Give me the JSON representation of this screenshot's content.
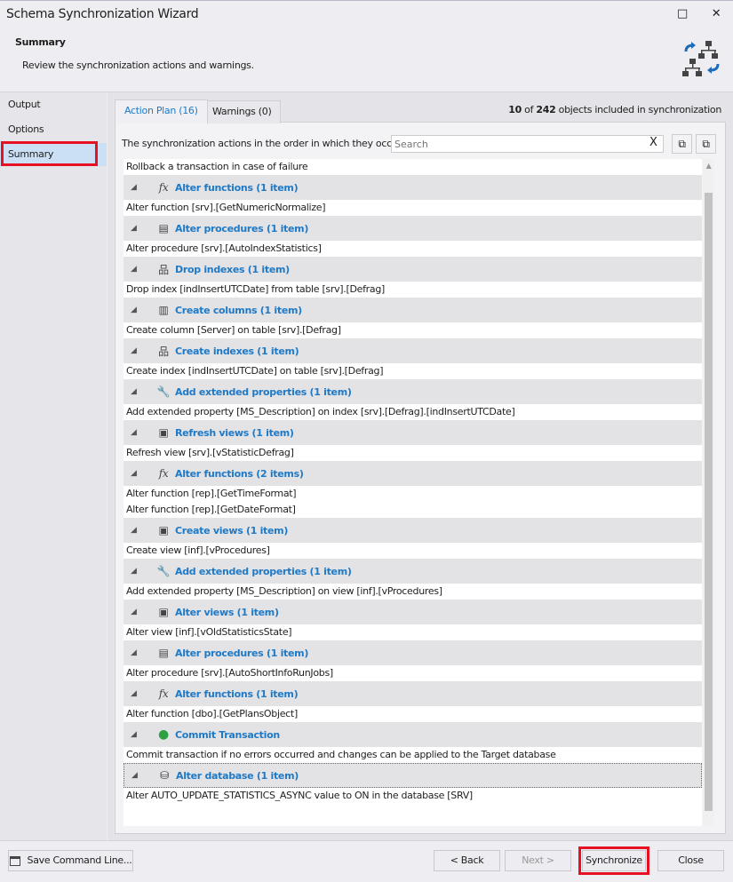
{
  "window": {
    "title": "Schema Synchronization Wizard",
    "maximize_icon": "□",
    "close_icon": "✕"
  },
  "header": {
    "title": "Summary",
    "subtitle": "Review the synchronization actions and warnings."
  },
  "sidebar": {
    "items": [
      {
        "label": "Output"
      },
      {
        "label": "Options"
      },
      {
        "label": "Summary"
      }
    ]
  },
  "tabs": [
    {
      "label": "Action Plan (16)"
    },
    {
      "label": "Warnings (0)"
    }
  ],
  "count": {
    "included": "10",
    "of": " of ",
    "total": "242",
    "suffix": " objects included in synchronization"
  },
  "description": "The synchronization actions in the order in which they occur.",
  "search": {
    "placeholder": "Search",
    "value": "",
    "clear": "X"
  },
  "list": {
    "first": "Rollback a transaction in case of failure",
    "groups": [
      {
        "label": "Alter functions (1 item)",
        "icon": "fx",
        "items": [
          "Alter function [srv].[GetNumericNormalize]"
        ]
      },
      {
        "label": "Alter procedures (1 item)",
        "icon": "procedure",
        "items": [
          "Alter procedure [srv].[AutoIndexStatistics]"
        ]
      },
      {
        "label": "Drop indexes (1 item)",
        "icon": "index",
        "items": [
          "Drop index [indInsertUTCDate] from table [srv].[Defrag]"
        ]
      },
      {
        "label": "Create columns (1 item)",
        "icon": "column",
        "items": [
          "Create column [Server] on table [srv].[Defrag]"
        ]
      },
      {
        "label": "Create indexes (1 item)",
        "icon": "index",
        "items": [
          "Create index [indInsertUTCDate] on table [srv].[Defrag]"
        ]
      },
      {
        "label": "Add extended properties (1 item)",
        "icon": "wrench",
        "items": [
          "Add extended property [MS_Description] on index [srv].[Defrag].[indInsertUTCDate]"
        ]
      },
      {
        "label": "Refresh views (1 item)",
        "icon": "view",
        "items": [
          "Refresh view [srv].[vStatisticDefrag]"
        ]
      },
      {
        "label": "Alter functions (2 items)",
        "icon": "fx",
        "items": [
          "Alter function [rep].[GetTimeFormat]",
          "Alter function [rep].[GetDateFormat]"
        ]
      },
      {
        "label": "Create views (1 item)",
        "icon": "view",
        "items": [
          "Create view [inf].[vProcedures]"
        ]
      },
      {
        "label": "Add extended properties (1 item)",
        "icon": "wrench",
        "items": [
          "Add extended property [MS_Description] on view [inf].[vProcedures]"
        ]
      },
      {
        "label": "Alter views (1 item)",
        "icon": "view",
        "items": [
          "Alter view [inf].[vOldStatisticsState]"
        ]
      },
      {
        "label": "Alter procedures (1 item)",
        "icon": "procedure",
        "items": [
          "Alter procedure [srv].[AutoShortInfoRunJobs]"
        ]
      },
      {
        "label": "Alter functions (1 item)",
        "icon": "fx",
        "items": [
          "Alter function [dbo].[GetPlansObject]"
        ]
      },
      {
        "label": "Commit Transaction",
        "icon": "play",
        "items": [
          "Commit transaction if no errors occurred and changes can be applied to the Target database"
        ]
      },
      {
        "label": "Alter database (1 item)",
        "icon": "database",
        "items": [
          "Alter AUTO_UPDATE_STATISTICS_ASYNC value to ON in the database [SRV]"
        ]
      }
    ]
  },
  "buttons": {
    "save_cmd": "Save Command Line...",
    "back": "< Back",
    "next": "Next >",
    "sync": "Synchronize",
    "close": "Close"
  },
  "colors": {
    "accent": "#1e79c6",
    "highlight": "#e81123"
  }
}
